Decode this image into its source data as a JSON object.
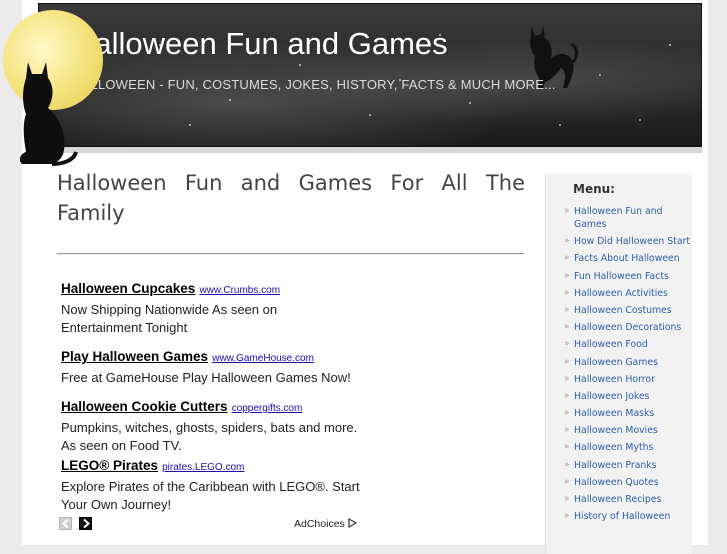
{
  "header": {
    "title": "Halloween Fun and Games",
    "tagline": "HALLOWEEN - FUN, COSTUMES, JOKES, HISTORY, FACTS & MUCH MORE..."
  },
  "main": {
    "title": "Halloween Fun and Games For All The Family"
  },
  "ads": {
    "items": [
      {
        "title": "Halloween Cupcakes",
        "url": "www.Crumbs.com",
        "desc": "Now Shipping Nationwide As seen on Entertainment Tonight"
      },
      {
        "title": "Play Halloween Games",
        "url": "www.GameHouse.com",
        "desc": "Free at GameHouse Play Halloween Games Now!"
      },
      {
        "title": "Halloween Cookie Cutters",
        "url": "coppergifts.com",
        "desc": "Pumpkins, witches, ghosts, spiders, bats and more. As seen on Food TV."
      },
      {
        "title": "LEGO® Pirates",
        "url": "pirates.LEGO.com",
        "desc": "Explore Pirates of the Caribbean with LEGO®. Start Your Own Journey!"
      }
    ],
    "adchoices_label": "AdChoices"
  },
  "sidebar": {
    "menu_title": "Menu:",
    "items": [
      {
        "label": "Halloween Fun and Games"
      },
      {
        "label": "How Did Halloween Start"
      },
      {
        "label": "Facts About Halloween"
      },
      {
        "label": "Fun Halloween Facts"
      },
      {
        "label": "Halloween Activities"
      },
      {
        "label": "Halloween Costumes"
      },
      {
        "label": "Halloween Decorations"
      },
      {
        "label": "Halloween Food"
      },
      {
        "label": "Halloween Games"
      },
      {
        "label": "Halloween Horror"
      },
      {
        "label": "Halloween Jokes"
      },
      {
        "label": "Halloween Masks"
      },
      {
        "label": "Halloween Movies"
      },
      {
        "label": "Halloween Myths"
      },
      {
        "label": "Halloween Pranks"
      },
      {
        "label": "Halloween Quotes"
      },
      {
        "label": "Halloween Recipes"
      },
      {
        "label": "History of Halloween"
      }
    ]
  },
  "colors": {
    "link": "#2c5fa8",
    "header_bg": "#262626",
    "moon": "#f4e27a"
  }
}
